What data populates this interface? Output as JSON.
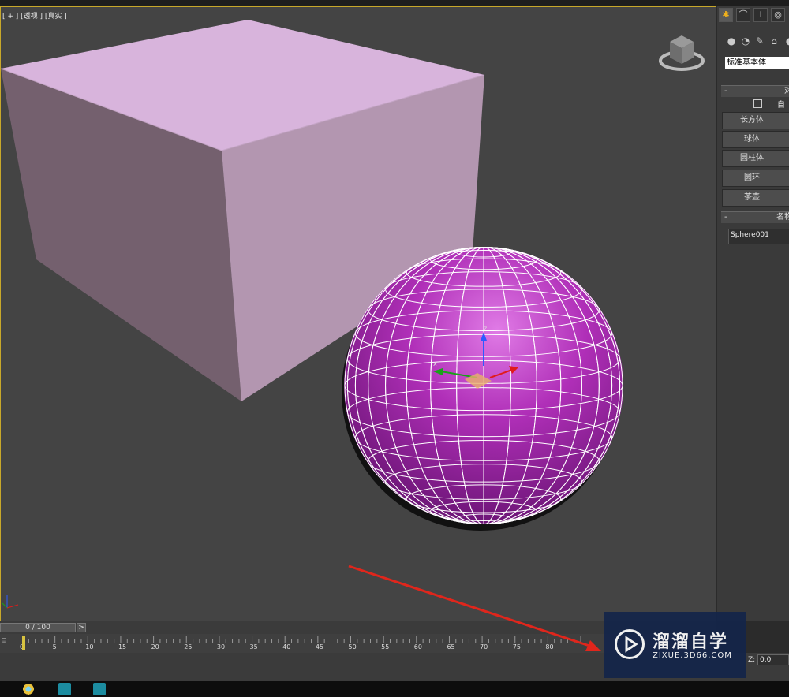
{
  "viewport": {
    "label": "[ + ] [透视 ] [真实 ]",
    "objects": [
      "box",
      "sphere"
    ],
    "box_color": "#d8b4dc",
    "sphere_color": "#b02fb8"
  },
  "command_panel": {
    "tabs": [
      "create-icon",
      "modify-icon",
      "hierarchy-icon",
      "motion-icon"
    ],
    "category_icons": [
      "geometry-icon",
      "shapes-icon",
      "lights-icon",
      "cameras-icon"
    ],
    "dropdown_value": "标准基本体",
    "object_type_rollout": {
      "minus": "-",
      "title": "对",
      "autogrid_label": "自动",
      "buttons": [
        "长方体",
        "球体",
        "圆柱体",
        "圆环",
        "茶壶"
      ]
    },
    "name_rollout": {
      "minus": "-",
      "title": "名称",
      "name_value": "Sphere001"
    }
  },
  "timeline": {
    "slider_label": "0 / 100",
    "next_label": ">",
    "tick_labels": [
      "0",
      "5",
      "10",
      "15",
      "20",
      "25",
      "30",
      "35",
      "40",
      "45",
      "50",
      "55",
      "60",
      "65",
      "70",
      "75",
      "80"
    ]
  },
  "status": {
    "z_label": "Z:",
    "z_value": "0.0"
  },
  "watermark": {
    "title": "溜溜自学",
    "subtitle": "ZIXUE.3D66.COM"
  },
  "colors": {
    "viewport_border": "#c8a82a",
    "arrow": "#e0261c",
    "accent": "#f2b21b"
  }
}
